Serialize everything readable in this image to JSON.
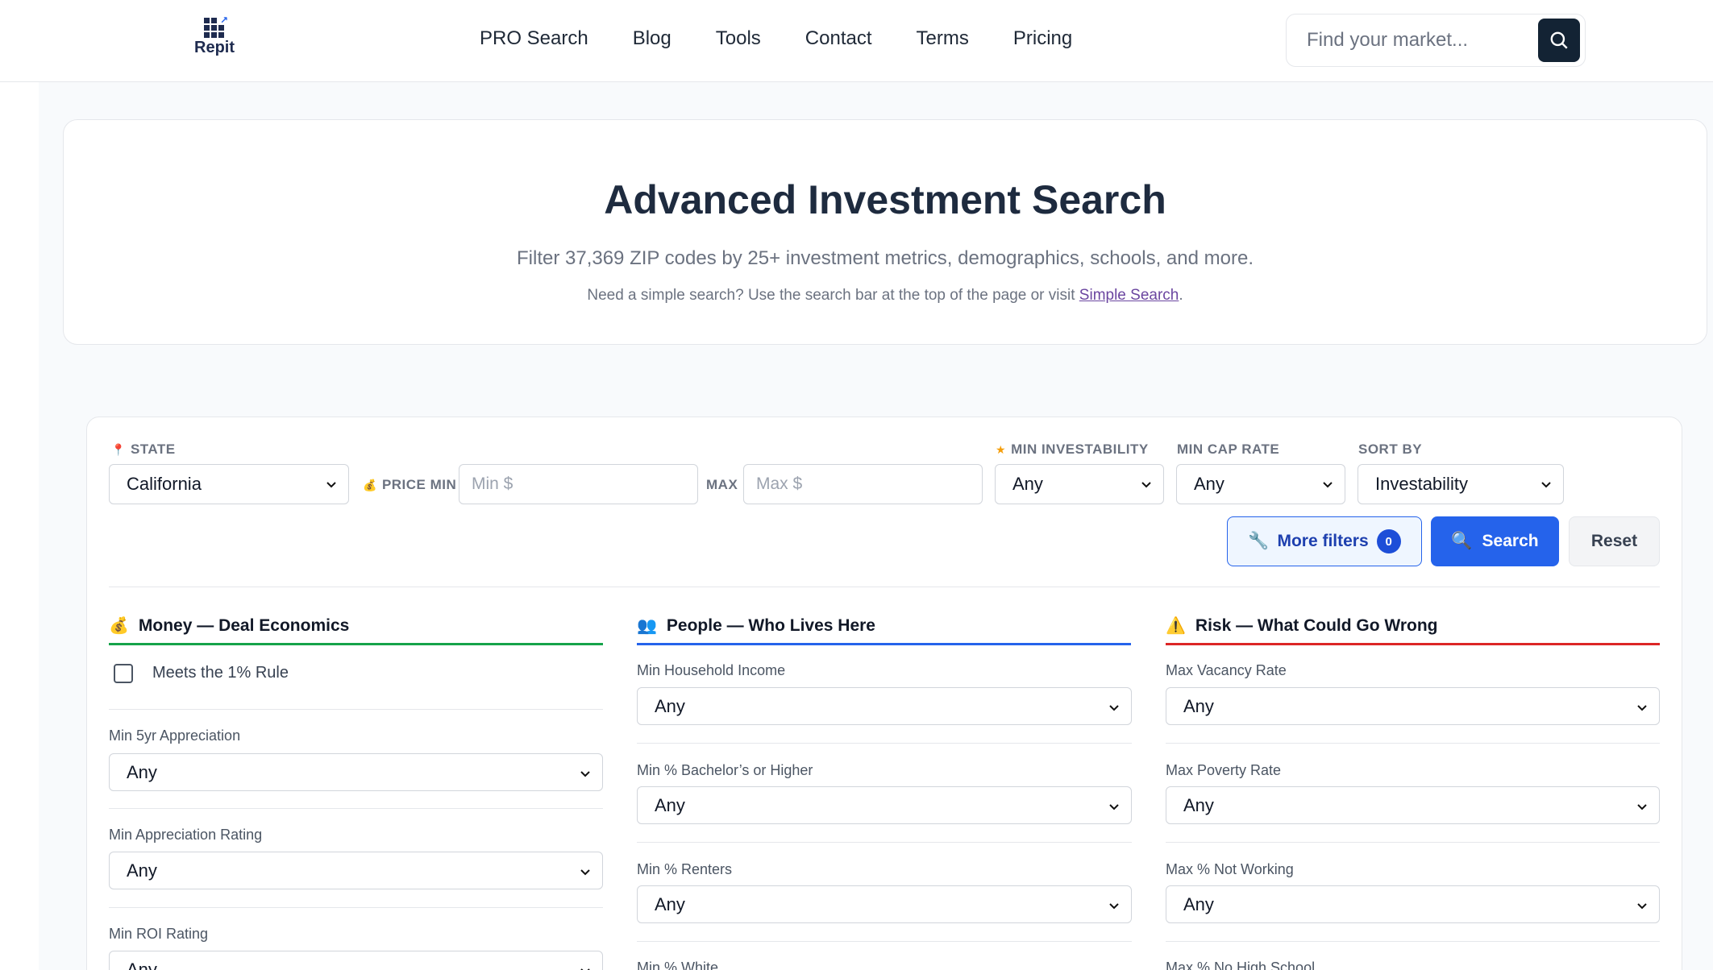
{
  "header": {
    "logo_text": "Repit",
    "nav": [
      "PRO Search",
      "Blog",
      "Tools",
      "Contact",
      "Terms",
      "Pricing"
    ],
    "search_placeholder": "Find your market..."
  },
  "hero": {
    "title": "Advanced Investment Search",
    "subtitle": "Filter 37,369 ZIP codes by 25+ investment metrics, demographics, schools, and more.",
    "note_text": "Need a simple search? Use the search bar at the top of the page or visit ",
    "note_link": "Simple Search",
    "note_end": "."
  },
  "filters": {
    "state": {
      "label": "STATE",
      "value": "California",
      "icon": "pin-icon"
    },
    "price_min": {
      "label": "PRICE MIN",
      "placeholder": "Min $",
      "icon": "money-bag-icon"
    },
    "price_max": {
      "label": "MAX",
      "placeholder": "Max $"
    },
    "min_investability": {
      "label": "MIN INVESTABILITY",
      "value": "Any",
      "icon": "star-icon"
    },
    "min_cap_rate": {
      "label": "MIN CAP RATE",
      "value": "Any"
    },
    "sort_by": {
      "label": "SORT BY",
      "value": "Investability"
    },
    "buttons": {
      "more": "More filters",
      "more_count": "0",
      "search": "Search",
      "reset": "Reset"
    }
  },
  "groups": {
    "money": {
      "title": "Money — Deal Economics",
      "icon": "money-bag-icon",
      "color": "#16a34a",
      "checkbox_label": "Meets the 1% Rule",
      "fields": [
        {
          "label": "Min 5yr Appreciation",
          "value": "Any"
        },
        {
          "label": "Min Appreciation Rating",
          "value": "Any"
        },
        {
          "label": "Min ROI Rating",
          "value": "Any"
        }
      ]
    },
    "people": {
      "title": "People — Who Lives Here",
      "icon": "people-icon",
      "color": "#2563eb",
      "fields": [
        {
          "label": "Min Household Income",
          "value": "Any"
        },
        {
          "label": "Min % Bachelor’s or Higher",
          "value": "Any"
        },
        {
          "label": "Min % Renters",
          "value": "Any"
        },
        {
          "label": "Min % White",
          "value": ""
        }
      ]
    },
    "risk": {
      "title": "Risk — What Could Go Wrong",
      "icon": "warning-icon",
      "color": "#dc2626",
      "fields": [
        {
          "label": "Max Vacancy Rate",
          "value": "Any"
        },
        {
          "label": "Max Poverty Rate",
          "value": "Any"
        },
        {
          "label": "Max % Not Working",
          "value": "Any"
        },
        {
          "label": "Max % No High School",
          "value": ""
        }
      ]
    }
  }
}
